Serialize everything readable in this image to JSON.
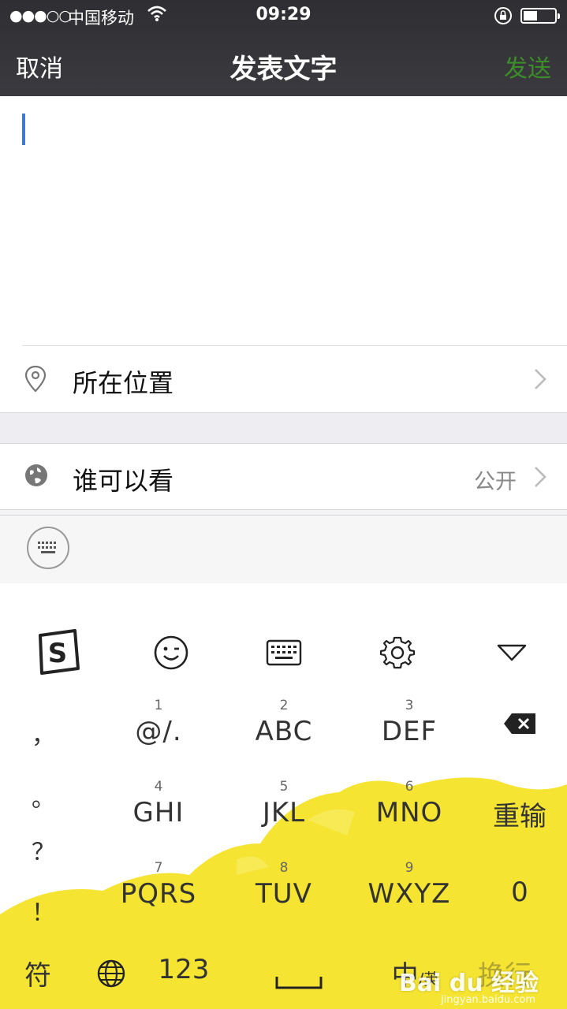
{
  "status_bar": {
    "signal": "●●●○○",
    "carrier": "中国移动",
    "time": "09:29"
  },
  "nav": {
    "cancel": "取消",
    "title": "发表文字",
    "send": "发送"
  },
  "compose": {
    "text": ""
  },
  "location_row": {
    "label": "所在位置",
    "icon": "location-pin-icon"
  },
  "visibility_row": {
    "label": "谁可以看",
    "value": "公开",
    "icon": "globe-icon"
  },
  "keyboard": {
    "toolbar": [
      "sogou-logo-icon",
      "emoji-icon",
      "keyboard-icon",
      "gear-icon",
      "collapse-icon"
    ],
    "punctuation": [
      "，",
      "。",
      "？",
      "！"
    ],
    "keys": [
      {
        "num": "1",
        "letters": "@/."
      },
      {
        "num": "2",
        "letters": "ABC"
      },
      {
        "num": "3",
        "letters": "DEF"
      },
      {
        "num": "4",
        "letters": "GHI"
      },
      {
        "num": "5",
        "letters": "JKL"
      },
      {
        "num": "6",
        "letters": "MNO"
      },
      {
        "num": "7",
        "letters": "PQRS"
      },
      {
        "num": "8",
        "letters": "TUV"
      },
      {
        "num": "9",
        "letters": "WXYZ"
      }
    ],
    "reenter": "重输",
    "zero": "0",
    "symbols": "符",
    "numbers": "123",
    "lang_main": "中",
    "lang_sub": "英",
    "enter": "换行"
  },
  "watermark": {
    "brand": "Bai du 经验",
    "url": "jingyan.baidu.com"
  },
  "colors": {
    "nav_bg": "#333337",
    "send_green": "#3d8c2a",
    "caret_blue": "#3a7bd5",
    "splash_yellow": "#f5e431"
  }
}
